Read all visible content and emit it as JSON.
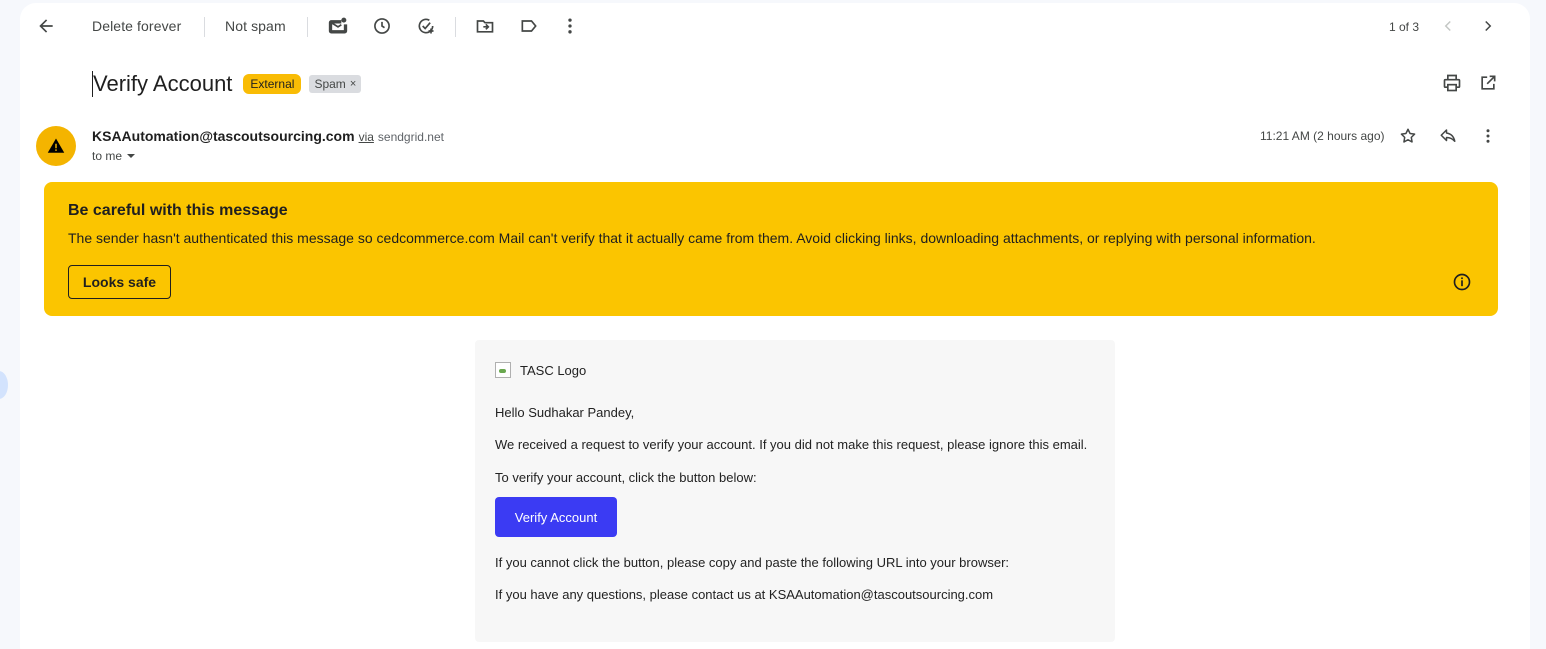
{
  "toolbar": {
    "delete_forever_label": "Delete forever",
    "not_spam_label": "Not spam",
    "pager_text": "1 of 3"
  },
  "message": {
    "subject": "Verify Account",
    "labels": {
      "external": "External",
      "spam": "Spam"
    },
    "sender_email": "KSAAutomation@tascoutsourcing.com",
    "via_label": "via",
    "via_domain": "sendgrid.net",
    "recipient_label": "to me",
    "timestamp": "11:21 AM (2 hours ago)"
  },
  "warning": {
    "title": "Be careful with this message",
    "text": "The sender hasn't authenticated this message so cedcommerce.com Mail can't verify that it actually came from them. Avoid clicking links, downloading attachments, or replying with personal information.",
    "looks_safe_label": "Looks safe"
  },
  "email_body": {
    "logo_alt": "TASC Logo",
    "greeting": "Hello Sudhakar Pandey,",
    "paragraph1": "We received a request to verify your account. If you did not make this request, please ignore this email.",
    "paragraph2": "To verify your account, click the button below:",
    "button_label": "Verify Account",
    "paragraph3": "If you cannot click the button, please copy and paste the following URL into your browser:",
    "paragraph4": "If you have any questions, please contact us at KSAAutomation@tascoutsourcing.com"
  },
  "colors": {
    "warning_bg": "#fbc500",
    "external_badge": "#f9bc05",
    "verify_button": "#3b3bf3",
    "avatar_bg": "#f4b400"
  }
}
